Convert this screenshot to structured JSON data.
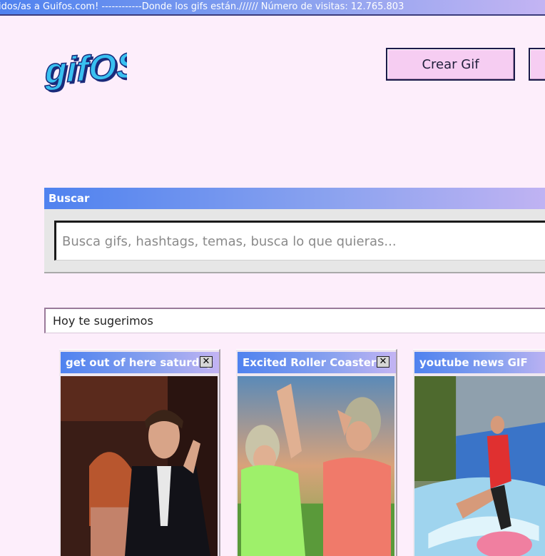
{
  "marquee": {
    "text": "idos/as a Guifos.com! ------------Donde los gifs están.////// Número de visitas: 12.765.803"
  },
  "header": {
    "logo_text": "gifOS",
    "create_gif_label": "Crear Gif"
  },
  "search": {
    "title": "Buscar",
    "placeholder": "Busca gifs, hashtags, temas, busca lo que quieras..."
  },
  "suggestions": {
    "title": "Hoy te sugerimos",
    "cards": [
      {
        "title": "get out of here saturday",
        "close_label": "✕"
      },
      {
        "title": "Excited Roller Coaster",
        "close_label": "✕"
      },
      {
        "title": "youtube news GIF"
      }
    ]
  },
  "colors": {
    "page_bg": "#fdeefb",
    "accent_gradient_start": "#4f82ef",
    "accent_gradient_end": "#c3b4f3",
    "button_bg": "#f6cdf2"
  }
}
